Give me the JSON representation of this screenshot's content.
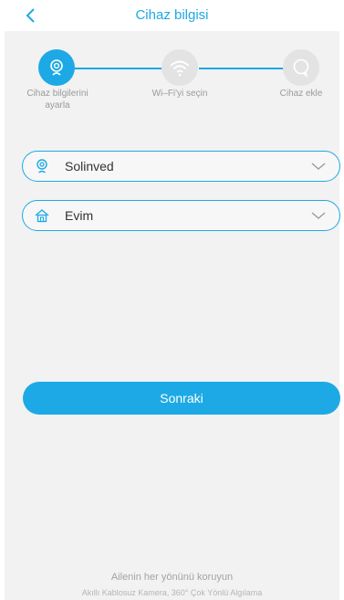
{
  "header": {
    "title": "Cihaz bilgisi",
    "back_icon": "chevron-left-icon"
  },
  "steps": [
    {
      "label_line1": "Cihaz bilgilerini",
      "label_line2": "ayarla",
      "icon": "camera-icon",
      "state": "active"
    },
    {
      "label_line1": "Wi–Fi'yi seçin",
      "label_line2": "",
      "icon": "wifi-icon",
      "state": "inactive"
    },
    {
      "label_line1": "Cihaz ekle",
      "label_line2": "",
      "icon": "chat-bubble-icon",
      "state": "inactive"
    }
  ],
  "device_select": {
    "value": "Solinved",
    "icon": "camera-icon"
  },
  "home_select": {
    "value": "Evim",
    "icon": "home-icon"
  },
  "next_button": {
    "label": "Sonraki"
  },
  "footer": {
    "tagline": "Ailenin her yönünü koruyun",
    "subtagline": "Akıllı Kablosuz Kamera, 360° Çok Yönlü Algılama"
  },
  "colors": {
    "accent": "#1da9e5",
    "inactive": "#e3e3e3",
    "background": "#f2f2f2"
  }
}
